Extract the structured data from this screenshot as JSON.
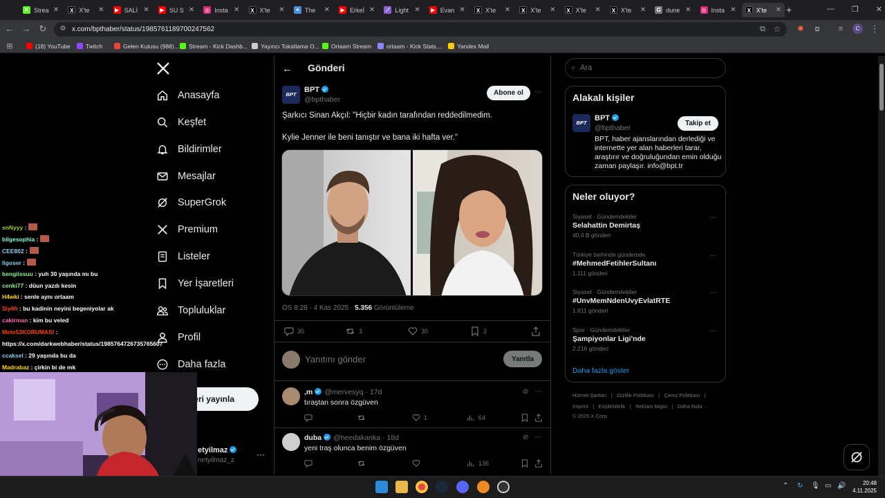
{
  "browser": {
    "tabs": [
      {
        "title": "Strea",
        "color": "#53fc18",
        "glyph": "K"
      },
      {
        "title": "X'te",
        "color": "#000000",
        "glyph": "X"
      },
      {
        "title": "SALİ",
        "color": "#ff0000",
        "glyph": "▶"
      },
      {
        "title": "SU S",
        "color": "#ff0000",
        "glyph": "▶"
      },
      {
        "title": "Insta",
        "color": "#d62976",
        "glyph": "◎"
      },
      {
        "title": "X'te",
        "color": "#000000",
        "glyph": "X"
      },
      {
        "title": "The",
        "color": "#4a90d9",
        "glyph": "✦"
      },
      {
        "title": "Erkeİ",
        "color": "#ff0000",
        "glyph": "▶"
      },
      {
        "title": "Light",
        "color": "#8a63d2",
        "glyph": "⟋"
      },
      {
        "title": "Evan",
        "color": "#ff0000",
        "glyph": "▶"
      },
      {
        "title": "X'te",
        "color": "#000000",
        "glyph": "X"
      },
      {
        "title": "X'te",
        "color": "#000000",
        "glyph": "X"
      },
      {
        "title": "X'te",
        "color": "#000000",
        "glyph": "X"
      },
      {
        "title": "X'te",
        "color": "#000000",
        "glyph": "X"
      },
      {
        "title": "dune",
        "color": "#777777",
        "glyph": "G"
      },
      {
        "title": "Insta",
        "color": "#d62976",
        "glyph": "◎"
      },
      {
        "title": "X'te",
        "color": "#000000",
        "glyph": "X"
      }
    ],
    "active_tab": 16,
    "url": "x.com/bpthaber/status/1985761189700247562",
    "bookmarks": [
      {
        "label": "(18) YouTube",
        "color": "#ff0000"
      },
      {
        "label": "Twitch",
        "color": "#9146ff"
      },
      {
        "label": "Gelen Kutusu (988)...",
        "color": "#ea4335"
      },
      {
        "label": "Stream - Kick Dashb...",
        "color": "#53fc18"
      },
      {
        "label": "Yayıncı Tokatlama O...",
        "color": "#cccccc"
      },
      {
        "label": "Ortaam Stream",
        "color": "#53fc18"
      },
      {
        "label": "ortaam - Kick Stats,...",
        "color": "#8888ff"
      },
      {
        "label": "Yandex Mail",
        "color": "#ffcc00"
      }
    ],
    "profile_letter": "C"
  },
  "sidebar": {
    "items": [
      {
        "label": "Anasayfa",
        "icon": "home-icon"
      },
      {
        "label": "Keşfet",
        "icon": "search-icon"
      },
      {
        "label": "Bildirimler",
        "icon": "bell-icon"
      },
      {
        "label": "Mesajlar",
        "icon": "mail-icon"
      },
      {
        "label": "SuperGrok",
        "icon": "grok-icon"
      },
      {
        "label": "Premium",
        "icon": "x-icon"
      },
      {
        "label": "Listeler",
        "icon": "list-icon"
      },
      {
        "label": "Yer İşaretleri",
        "icon": "bookmark-icon"
      },
      {
        "label": "Topluluklar",
        "icon": "people-icon"
      },
      {
        "label": "Profil",
        "icon": "person-icon"
      },
      {
        "label": "Daha fazla",
        "icon": "more-circle-icon"
      }
    ],
    "post_button": "eri yayınla",
    "account_name": "etyilmaz",
    "account_handle": "netyilmaz_z"
  },
  "post": {
    "header": "Gönderi",
    "author": "BPT",
    "handle": "@bpthaber",
    "avatar_text": "BPT",
    "subscribe": "Abone ol",
    "line1": "Şarkıcı Sinan Akçıl: \"Hiçbir kadın tarafından reddedilmedim.",
    "line2": "Kylie Jenner ile beni tanıştır ve bana iki hafta ver.\"",
    "time": "ÖS 8:28 · 4 Kas 2025 · ",
    "views": "5.356",
    "views_label": " Görüntüleme",
    "replies": "30",
    "reposts": "3",
    "likes": "30",
    "bookmarks": "3",
    "reply_placeholder": "Yanıtını gönder",
    "reply_button": "Yanıtla"
  },
  "replies": [
    {
      "name": ",m",
      "handle": "@mervesyq",
      "age": "· 17d",
      "text": "tıraştan sonra özgüven",
      "likes": "1",
      "views": "64"
    },
    {
      "name": "duba",
      "handle": "@heedakanka",
      "age": "· 18d",
      "text": "yeni traş olunca benim özgüven",
      "likes": "",
      "views": "136"
    }
  ],
  "right": {
    "search_placeholder": "Ara",
    "people_title": "Alakalı kişiler",
    "person_name": "BPT",
    "person_handle": "@bpthaber",
    "follow": "Takip et",
    "bio1": "BPT, haber ajanslarından derlediği ve",
    "bio2": "internette yer alan haberleri tarar,",
    "bio3": "araştırır ve doğruluğundan emin olduğu",
    "bio4": "zaman paylaşır. info@bpt.tr",
    "trends_title": "Neler oluyor?",
    "trends": [
      {
        "context": "Siyaset · Gündemdekiler",
        "title": "Selahattin Demirtaş",
        "count": "40,4 B gönderi"
      },
      {
        "context": "Türkiye tarihinde gündemde",
        "title": "#MehmedFetihlerSultanı",
        "count": "1.111 gönderi"
      },
      {
        "context": "Siyaset · Gündemdekiler",
        "title": "#UnvMemNdenUvyEvlatRTE",
        "count": "1.811 gönderi"
      },
      {
        "context": "Spor · Gündemdekiler",
        "title": "Şampiyonlar Ligi'nde",
        "count": "2.216 gönderi"
      }
    ],
    "show_more": "Daha fazla göster",
    "footer1": [
      "Hizmet Şartları",
      "|",
      "Gizlilik Politikası",
      "|",
      "Çerez Politikası",
      "|"
    ],
    "footer2": [
      "Imprint",
      "|",
      "Erişilebilirlik",
      "|",
      "Reklam bilgisi",
      "|",
      "Daha fazla ···"
    ],
    "copyright": "© 2025 X Corp."
  },
  "chat": [
    {
      "user": "snNyyy",
      "text": " :",
      "color": "#9acd32",
      "emote": true
    },
    {
      "user": "bilgesophia",
      "text": " :",
      "color": "#7fffd4",
      "emote": true
    },
    {
      "user": "CEE802",
      "text": " :",
      "color": "#87ceeb",
      "emote": true
    },
    {
      "user": "ligoser",
      "text": " :",
      "color": "#87ceeb",
      "emote": true
    },
    {
      "user": "bengiissuu",
      "text": " : yuh 30 yaşında mı bu",
      "color": "#90ee90",
      "emote": false
    },
    {
      "user": "cenki77",
      "text": " : düun yazdı kesin",
      "color": "#90ee90",
      "emote": false
    },
    {
      "user": "H4wki",
      "text": " : senle aynı ortaam",
      "color": "#ffd700",
      "emote": false
    },
    {
      "user": "Siy6h",
      "text": " : bu kadinin neyini begeniyolar ak",
      "color": "#ff4500",
      "emote": false
    },
    {
      "user": "cakirman",
      "text": " : kim bu veled",
      "color": "#ff69b4",
      "emote": false
    },
    {
      "user": "Mete53KORUMASI",
      "text": " :",
      "color": "#ff4500",
      "emote": false
    },
    {
      "user": "",
      "text": "https://x.com/darkwebhaber/status/1985764726735765607",
      "color": "#ffffff",
      "emote": false
    },
    {
      "user": "ccaksel",
      "text": " : 29 yaşında bu da",
      "color": "#87ceeb",
      "emote": false
    },
    {
      "user": "Madrabaz",
      "text": " : çirkin bi de mk",
      "color": "#ffd700",
      "emote": false
    }
  ],
  "taskbar": {
    "time": "20:48",
    "date": "4.11.2025"
  }
}
